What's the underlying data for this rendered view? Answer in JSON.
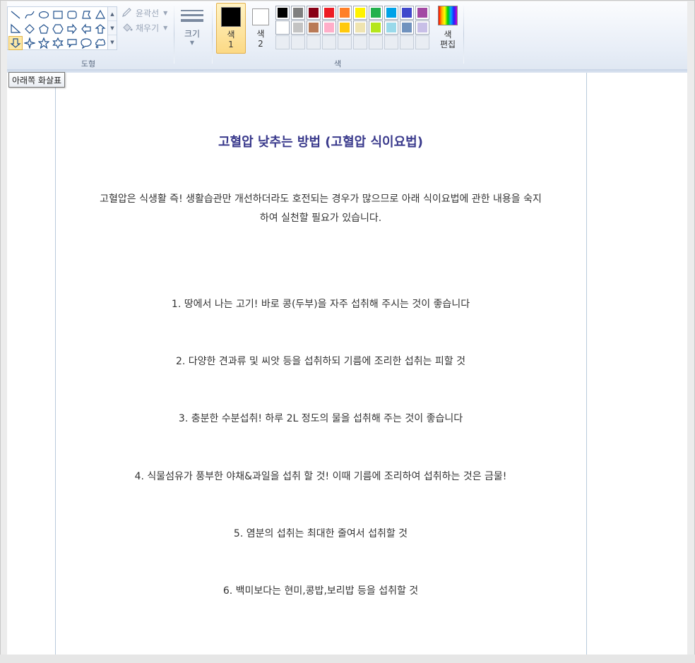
{
  "ribbon": {
    "shapes_group_label": "도형",
    "outline_label": "윤곽선",
    "fill_label": "채우기",
    "size_label": "크기",
    "color1_label_line1": "색",
    "color1_label_line2": "1",
    "color2_label_line1": "색",
    "color2_label_line2": "2",
    "colors_group_label": "색",
    "edit_colors_line1": "색",
    "edit_colors_line2": "편집",
    "color1_value": "#000000",
    "color2_value": "#ffffff",
    "palette_row1": [
      "#000000",
      "#7f7f7f",
      "#880015",
      "#ed1c24",
      "#ff7f27",
      "#fff200",
      "#22b14c",
      "#00a2e8",
      "#3f48cc",
      "#a349a4"
    ],
    "palette_row2": [
      "#ffffff",
      "#c3c3c3",
      "#b97a57",
      "#ffaec9",
      "#ffc90e",
      "#efe4b0",
      "#b5e61d",
      "#99d9ea",
      "#7092be",
      "#c8bfe7"
    ]
  },
  "tooltip": "아래쪽 화살표",
  "document": {
    "title": "고혈압 낮추는 방법 (고혈압 식이요법)",
    "intro_line1": "고혈압은 식생활 즉! 생활습관만 개선하더라도 호전되는 경우가 많으므로 아래 식이요법에 관한 내용을 숙지",
    "intro_line2": "하여 실천할 필요가 있습니다.",
    "items": [
      "1. 땅에서 나는 고기! 바로 콩(두부)을 자주 섭취해 주시는 것이 좋습니다",
      "2. 다양한 견과류 및 씨앗 등을 섭취하되 기름에 조리한 섭취는 피할 것",
      "3. 충분한 수분섭취! 하루 2L 정도의 물을 섭취해 주는 것이 좋습니다",
      "4. 식물섬유가 풍부한 야채&과일을 섭취 할 것! 이때 기름에 조리하여 섭취하는 것은 금물!",
      "5. 염분의 섭취는 최대한 줄여서 섭취할 것",
      "6.  백미보다는 현미,콩밥,보리밥 등을 섭취할 것"
    ]
  }
}
